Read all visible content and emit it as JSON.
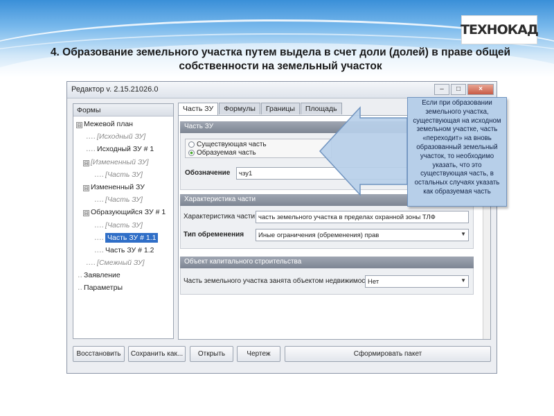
{
  "slide": {
    "title": "4. Образование земельного участка путем выдела в счет доли (долей) в праве общей собственности на земельный участок",
    "logo_text": "ТЕХНОКАД"
  },
  "window": {
    "title": "Редактор v. 2.15.21026.0",
    "buttons": {
      "min": "–",
      "max": "□",
      "close": "×"
    }
  },
  "tree": {
    "header": "Формы",
    "items": [
      {
        "label": "Межевой план",
        "toggle": "⊟"
      },
      {
        "label": "[Исходный ЗУ]",
        "prefix": "‥‥"
      },
      {
        "label": "Исходный ЗУ # 1",
        "prefix": "‥‥"
      },
      {
        "label": "[Измененный ЗУ]",
        "toggle": "⊟"
      },
      {
        "label": "[Часть ЗУ]",
        "prefix": "‥‥"
      },
      {
        "label": "Измененный ЗУ",
        "toggle": "⊟"
      },
      {
        "label": "[Часть ЗУ]",
        "prefix": "‥‥"
      },
      {
        "label": "Образующийся ЗУ # 1",
        "toggle": "⊟"
      },
      {
        "label": "[Часть ЗУ]",
        "prefix": "‥‥"
      },
      {
        "label": "Часть ЗУ # 1.1",
        "prefix": "‥‥"
      },
      {
        "label": "Часть ЗУ # 1.2",
        "prefix": "‥‥"
      },
      {
        "label": "[Смежный ЗУ]",
        "prefix": "‥‥"
      },
      {
        "label": "Заявление",
        "prefix": "‥"
      },
      {
        "label": "Параметры",
        "prefix": "‥"
      }
    ]
  },
  "tabs": [
    "Часть ЗУ",
    "Формулы",
    "Границы",
    "Площадь"
  ],
  "part_section": {
    "header": "Часть ЗУ",
    "radio_existing": "Существующая часть",
    "radio_forming": "Образуемая часть",
    "designation_label": "Обозначение",
    "designation_value": "чзу1"
  },
  "characteristic_section": {
    "header": "Характеристика части",
    "char_label": "Характеристика части",
    "char_value": "часть земельного участка в пределах охранной зоны ТЛФ",
    "encumbrance_label": "Тип обременения",
    "encumbrance_value": "Иные ограничения (обременения) прав"
  },
  "capital_section": {
    "header": "Объект капитального строительства",
    "occupied_label": "Часть земельного участка занята объектом недвижимости",
    "occupied_value": "Нет"
  },
  "buttons": {
    "restore": "Восстановить",
    "save_as": "Сохранить как...",
    "open": "Открыть",
    "drawing": "Чертеж",
    "build_package": "Сформировать пакет"
  },
  "callout": {
    "text": "Если при образовании земельного участка, существующая на исходном земельном участке, часть «переходит» на вновь образованный земельный участок, то необходимо указать, что это существующая часть, в остальных случаях указать как образуемая часть"
  }
}
